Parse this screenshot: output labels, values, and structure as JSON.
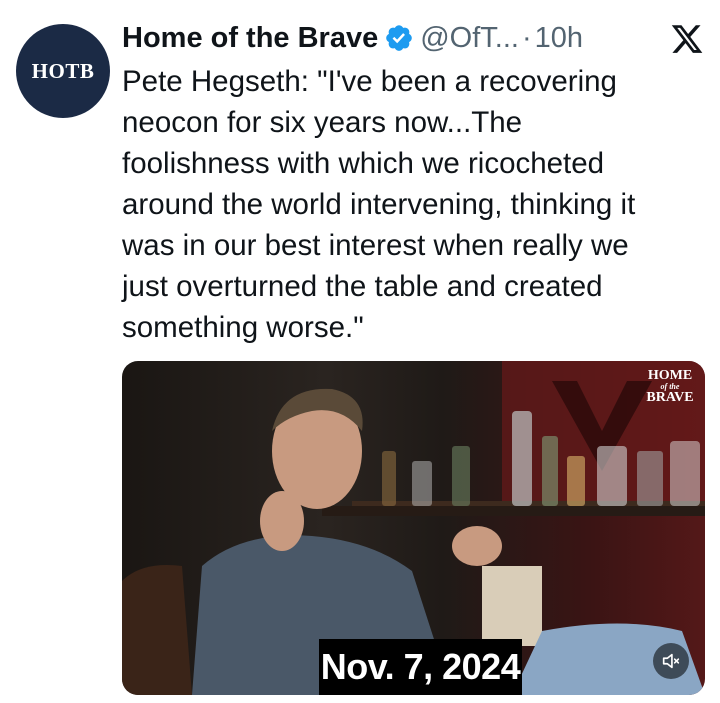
{
  "author": {
    "avatar_text": "HOTB",
    "name": "Home of the Brave",
    "handle": "@OfT...",
    "separator": "·",
    "time": "10h",
    "verified": true
  },
  "icons": {
    "verified": "verified-badge-icon",
    "platform": "x-logo-icon",
    "mute": "speaker-muted-icon"
  },
  "tweet": {
    "text": "Pete Hegseth: \"I've been a recovering\nneocon for six years now...The\nfoolishness with which we ricocheted\naround the world intervening, thinking it\nwas in our best interest when really we\njust overturned the table and created\nsomething worse.\""
  },
  "media": {
    "watermark_line1": "HOME",
    "watermark_line2": "of the",
    "watermark_line3": "BRAVE",
    "date_overlay": "Nov. 7, 2024"
  },
  "colors": {
    "verified_blue": "#1d9bf0",
    "avatar_bg": "#1b2a45",
    "secondary_text": "#536471"
  }
}
